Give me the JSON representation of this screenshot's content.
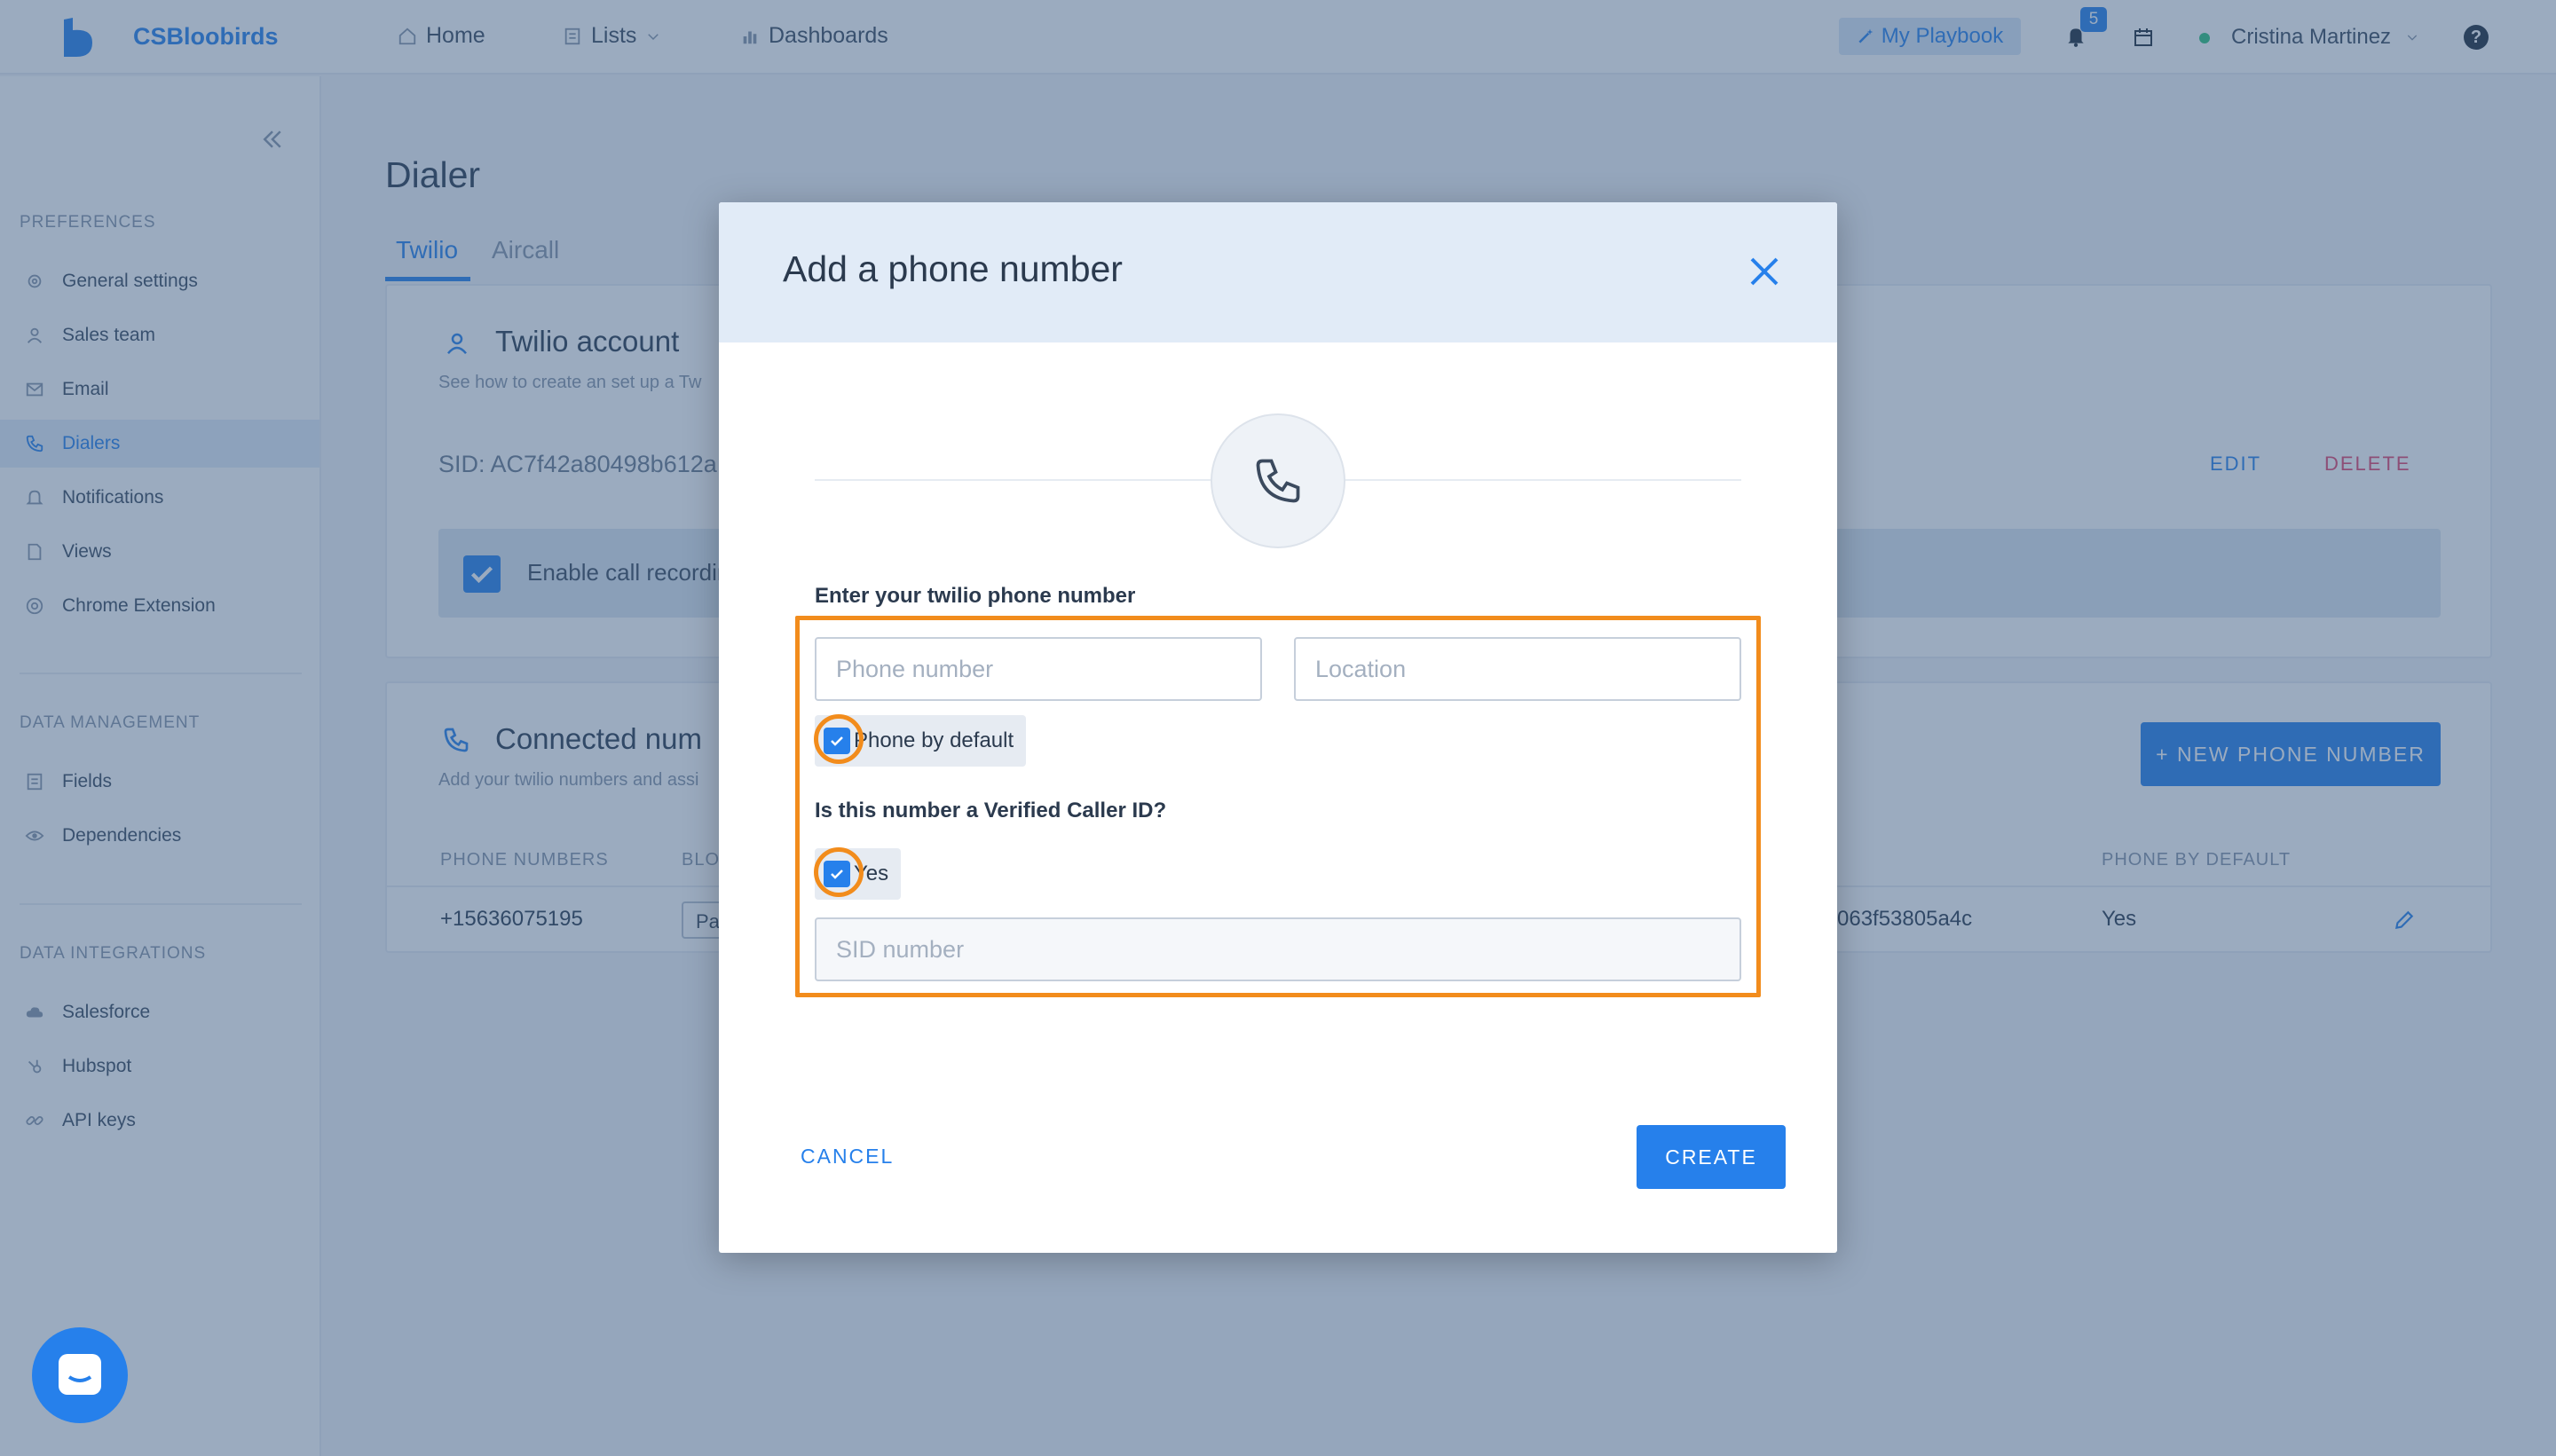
{
  "app": {
    "brand": "CSBloobirds"
  },
  "nav": {
    "home": "Home",
    "lists": "Lists",
    "dashboards": "Dashboards",
    "playbook": "My Playbook",
    "notifications_count": "5",
    "user_name": "Cristina Martinez",
    "help": "?"
  },
  "sidebar": {
    "preferences_heading": "PREFERENCES",
    "preferences": [
      {
        "label": "General settings",
        "icon": "gear-icon"
      },
      {
        "label": "Sales team",
        "icon": "person-icon"
      },
      {
        "label": "Email",
        "icon": "envelope-icon"
      },
      {
        "label": "Dialers",
        "icon": "phone-icon",
        "active": true
      },
      {
        "label": "Notifications",
        "icon": "bell-icon"
      },
      {
        "label": "Views",
        "icon": "document-icon"
      },
      {
        "label": "Chrome Extension",
        "icon": "chrome-icon"
      }
    ],
    "data_management_heading": "DATA MANAGEMENT",
    "data_management": [
      {
        "label": "Fields",
        "icon": "list-icon"
      },
      {
        "label": "Dependencies",
        "icon": "eye-icon"
      }
    ],
    "data_integrations_heading": "DATA INTEGRATIONS",
    "data_integrations": [
      {
        "label": "Salesforce",
        "icon": "cloud-icon"
      },
      {
        "label": "Hubspot",
        "icon": "hubspot-icon"
      },
      {
        "label": "API keys",
        "icon": "link-icon"
      }
    ]
  },
  "page": {
    "title": "Dialer",
    "tabs": [
      "Twilio",
      "Aircall"
    ],
    "account_card": {
      "title": "Twilio account",
      "subtitle": "See how to create an set up a Tw",
      "sid": "SID: AC7f42a80498b612a",
      "edit": "EDIT",
      "delete": "DELETE",
      "enable_recording": "Enable call recordin"
    },
    "numbers_card": {
      "title": "Connected num",
      "subtitle": "Add your twilio numbers and assi",
      "new_button": "+ NEW PHONE NUMBER",
      "columns": [
        "PHONE NUMBERS",
        "BLO",
        "PHONE BY DEFAULT"
      ],
      "rows": [
        {
          "phone": "+15636075195",
          "pill": "Pa",
          "sid_tail": "063f53805a4c",
          "by_default": "Yes"
        }
      ]
    }
  },
  "modal": {
    "title": "Add a phone number",
    "phone_label": "Enter your twilio phone number",
    "phone_placeholder": "Phone number",
    "location_placeholder": "Location",
    "phone_by_default_label": "Phone by default",
    "verified_question": "Is this number a Verified Caller ID?",
    "yes_label": "Yes",
    "sid_placeholder": "SID number",
    "cancel": "CANCEL",
    "create": "CREATE"
  },
  "colors": {
    "accent": "#2680eb",
    "danger": "#e2456c",
    "highlight": "#f28c1c"
  }
}
